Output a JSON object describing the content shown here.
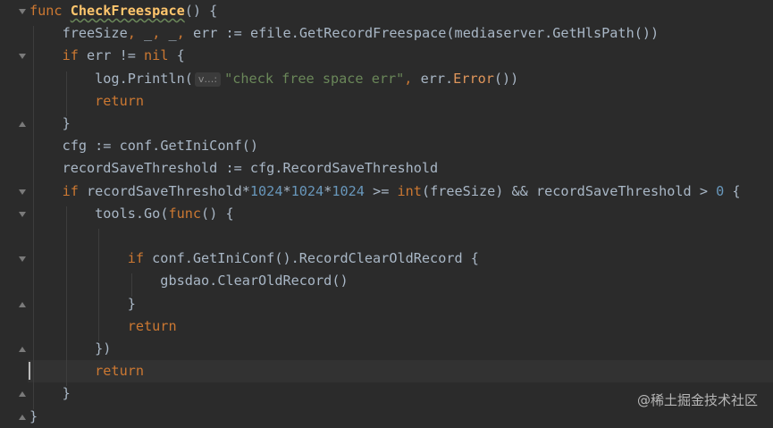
{
  "editor": {
    "lines": [
      {
        "parts": [
          [
            "kw",
            "func "
          ],
          [
            "fn",
            "CheckFreespace"
          ],
          [
            "pkg",
            "() {"
          ]
        ]
      },
      {
        "parts": [
          [
            "pkg",
            "    freeSize"
          ],
          [
            "kw",
            ", "
          ],
          [
            "pkg",
            "_"
          ],
          [
            "kw",
            ", "
          ],
          [
            "pkg",
            "_"
          ],
          [
            "kw",
            ", "
          ],
          [
            "pkg",
            "err := efile."
          ],
          [
            "meth",
            "GetRecordFreespace"
          ],
          [
            "pkg",
            "(mediaserver."
          ],
          [
            "meth",
            "GetHlsPath"
          ],
          [
            "pkg",
            "())"
          ]
        ]
      },
      {
        "parts": [
          [
            "kw",
            "    if "
          ],
          [
            "pkg",
            "err != "
          ],
          [
            "kw",
            "nil "
          ],
          [
            "pkg",
            "{"
          ]
        ]
      },
      {
        "parts": [
          [
            "pkg",
            "        log."
          ],
          [
            "meth",
            "Println"
          ],
          [
            "pkg",
            "("
          ],
          [
            "hint",
            "v…:"
          ],
          [
            "str",
            "\"check free space err\""
          ],
          [
            "kw",
            ", "
          ],
          [
            "pkg",
            "err."
          ],
          [
            "err",
            "Error"
          ],
          [
            "pkg",
            "())"
          ]
        ]
      },
      {
        "parts": [
          [
            "kw",
            "        return"
          ]
        ]
      },
      {
        "parts": [
          [
            "pkg",
            "    }"
          ]
        ]
      },
      {
        "parts": [
          [
            "pkg",
            "    cfg := conf."
          ],
          [
            "meth",
            "GetIniConf"
          ],
          [
            "pkg",
            "()"
          ]
        ]
      },
      {
        "parts": [
          [
            "pkg",
            "    recordSaveThreshold := cfg.RecordSaveThreshold"
          ]
        ]
      },
      {
        "parts": [
          [
            "kw",
            "    if "
          ],
          [
            "pkg",
            "recordSaveThreshold*"
          ],
          [
            "num",
            "1024"
          ],
          [
            "pkg",
            "*"
          ],
          [
            "num",
            "1024"
          ],
          [
            "pkg",
            "*"
          ],
          [
            "num",
            "1024"
          ],
          [
            "pkg",
            " >= "
          ],
          [
            "kw",
            "int"
          ],
          [
            "pkg",
            "(freeSize) && recordSaveThreshold > "
          ],
          [
            "num",
            "0"
          ],
          [
            "pkg",
            " {"
          ]
        ]
      },
      {
        "parts": [
          [
            "pkg",
            "        tools."
          ],
          [
            "meth",
            "Go"
          ],
          [
            "pkg",
            "("
          ],
          [
            "kw",
            "func"
          ],
          [
            "pkg",
            "() {"
          ]
        ]
      },
      {
        "parts": [
          [
            "pkg",
            ""
          ]
        ]
      },
      {
        "parts": [
          [
            "kw",
            "            if "
          ],
          [
            "pkg",
            "conf."
          ],
          [
            "meth",
            "GetIniConf"
          ],
          [
            "pkg",
            "()."
          ],
          [
            "meth",
            "RecordClearOldRecord"
          ],
          [
            "pkg",
            " {"
          ]
        ]
      },
      {
        "parts": [
          [
            "pkg",
            "                gbsdao."
          ],
          [
            "meth",
            "ClearOldRecord"
          ],
          [
            "pkg",
            "()"
          ]
        ]
      },
      {
        "parts": [
          [
            "pkg",
            "            }"
          ]
        ]
      },
      {
        "parts": [
          [
            "kw",
            "            return"
          ]
        ]
      },
      {
        "parts": [
          [
            "pkg",
            "        })"
          ]
        ]
      },
      {
        "parts": [
          [
            "kw",
            "        return"
          ]
        ]
      },
      {
        "parts": [
          [
            "pkg",
            "    }"
          ]
        ]
      },
      {
        "parts": [
          [
            "pkg",
            "}"
          ]
        ]
      }
    ]
  },
  "watermark": "@稀土掘金技术社区"
}
